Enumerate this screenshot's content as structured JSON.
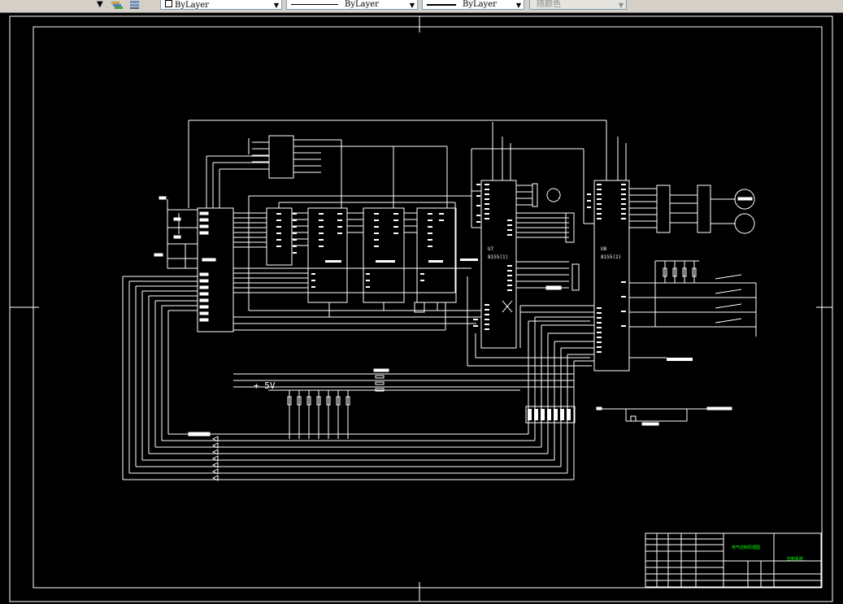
{
  "toolbar": {
    "dropdown_arrow": "▼",
    "layer_icon_1": "layers-icon",
    "layer_icon_2": "layer-stack-icon",
    "color_control": "ByLayer",
    "linetype_control": "ByLayer",
    "lineweight_control": "ByLayer",
    "plotstyle_control": "随颜色"
  },
  "drawing": {
    "power_label": "+ 5V",
    "u7_label": "U7",
    "u7_part": "8155(1)",
    "u8_label": "U8",
    "u8_part": "8155(2)",
    "title_block": {
      "drawing_title": "电气控制原理图",
      "system_name": "控制系统"
    }
  },
  "colors": {
    "background": "#000000",
    "lines": "#ffffff",
    "titleblock_text": "#00ff00",
    "toolbar": "#d4d0c8"
  }
}
